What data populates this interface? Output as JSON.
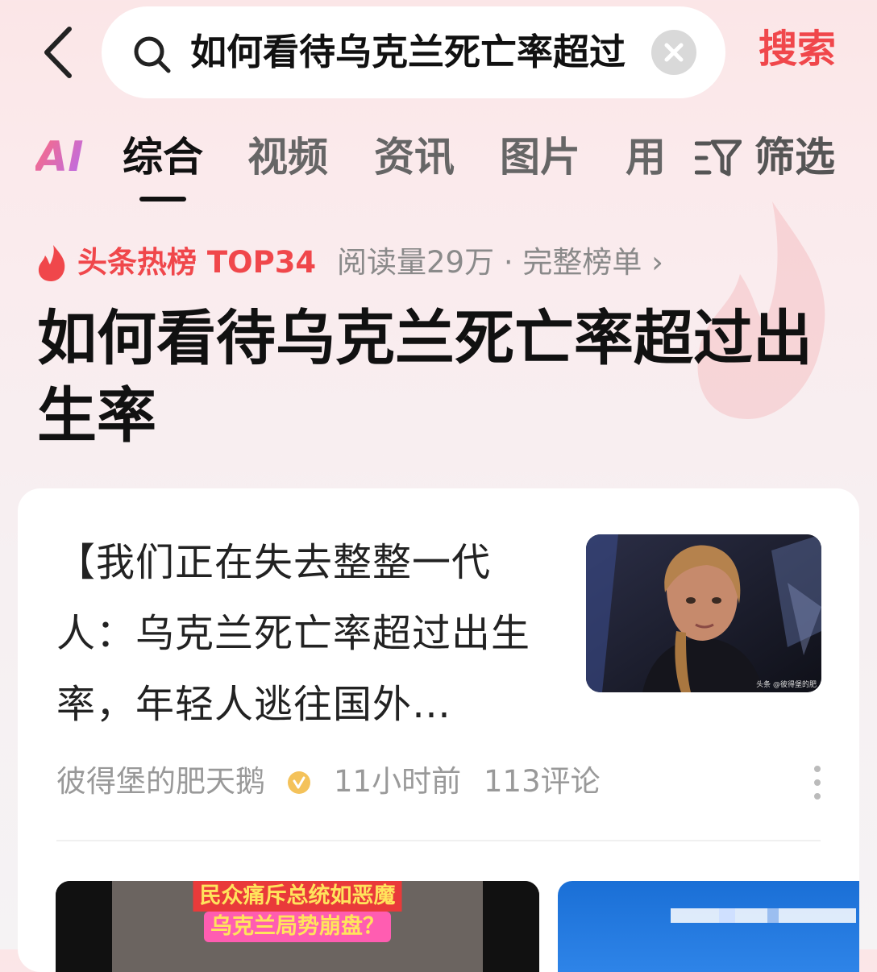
{
  "header": {
    "back_icon": "chevron-left-icon",
    "search_query": "如何看待乌克兰死亡率超过出生率",
    "search_icon": "search-icon",
    "clear_icon": "close-icon",
    "submit_label": "搜索"
  },
  "tabs": {
    "ai_label": "AI",
    "items": [
      {
        "label": "综合",
        "active": true
      },
      {
        "label": "视频"
      },
      {
        "label": "资讯"
      },
      {
        "label": "图片"
      },
      {
        "label": "用"
      }
    ],
    "filter_label": "筛选",
    "filter_icon": "filter-icon"
  },
  "hot": {
    "icon": "fire-icon",
    "label": "头条热榜 TOP34",
    "meta": "阅读量29万 · 完整榜单 ›"
  },
  "topic_title": "如何看待乌克兰死亡率超过出生率",
  "article": {
    "title": "【我们正在失去整整一代人：乌克兰死亡率超过出生率，年轻人逃往国外…",
    "thumb_watermark": "头条 @彼得堡的肥",
    "author": "彼得堡的肥天鹅",
    "verify_icon": "verified-badge-icon",
    "time": "11小时前",
    "comments": "113评论",
    "more_icon": "more-vertical-icon"
  },
  "video": {
    "caption_1": "民众痛斥总统如恶魔",
    "caption_2": "乌克兰局势崩盘？"
  },
  "colors": {
    "accent": "#f0474b",
    "text_primary": "#111111",
    "text_secondary": "#999999"
  }
}
